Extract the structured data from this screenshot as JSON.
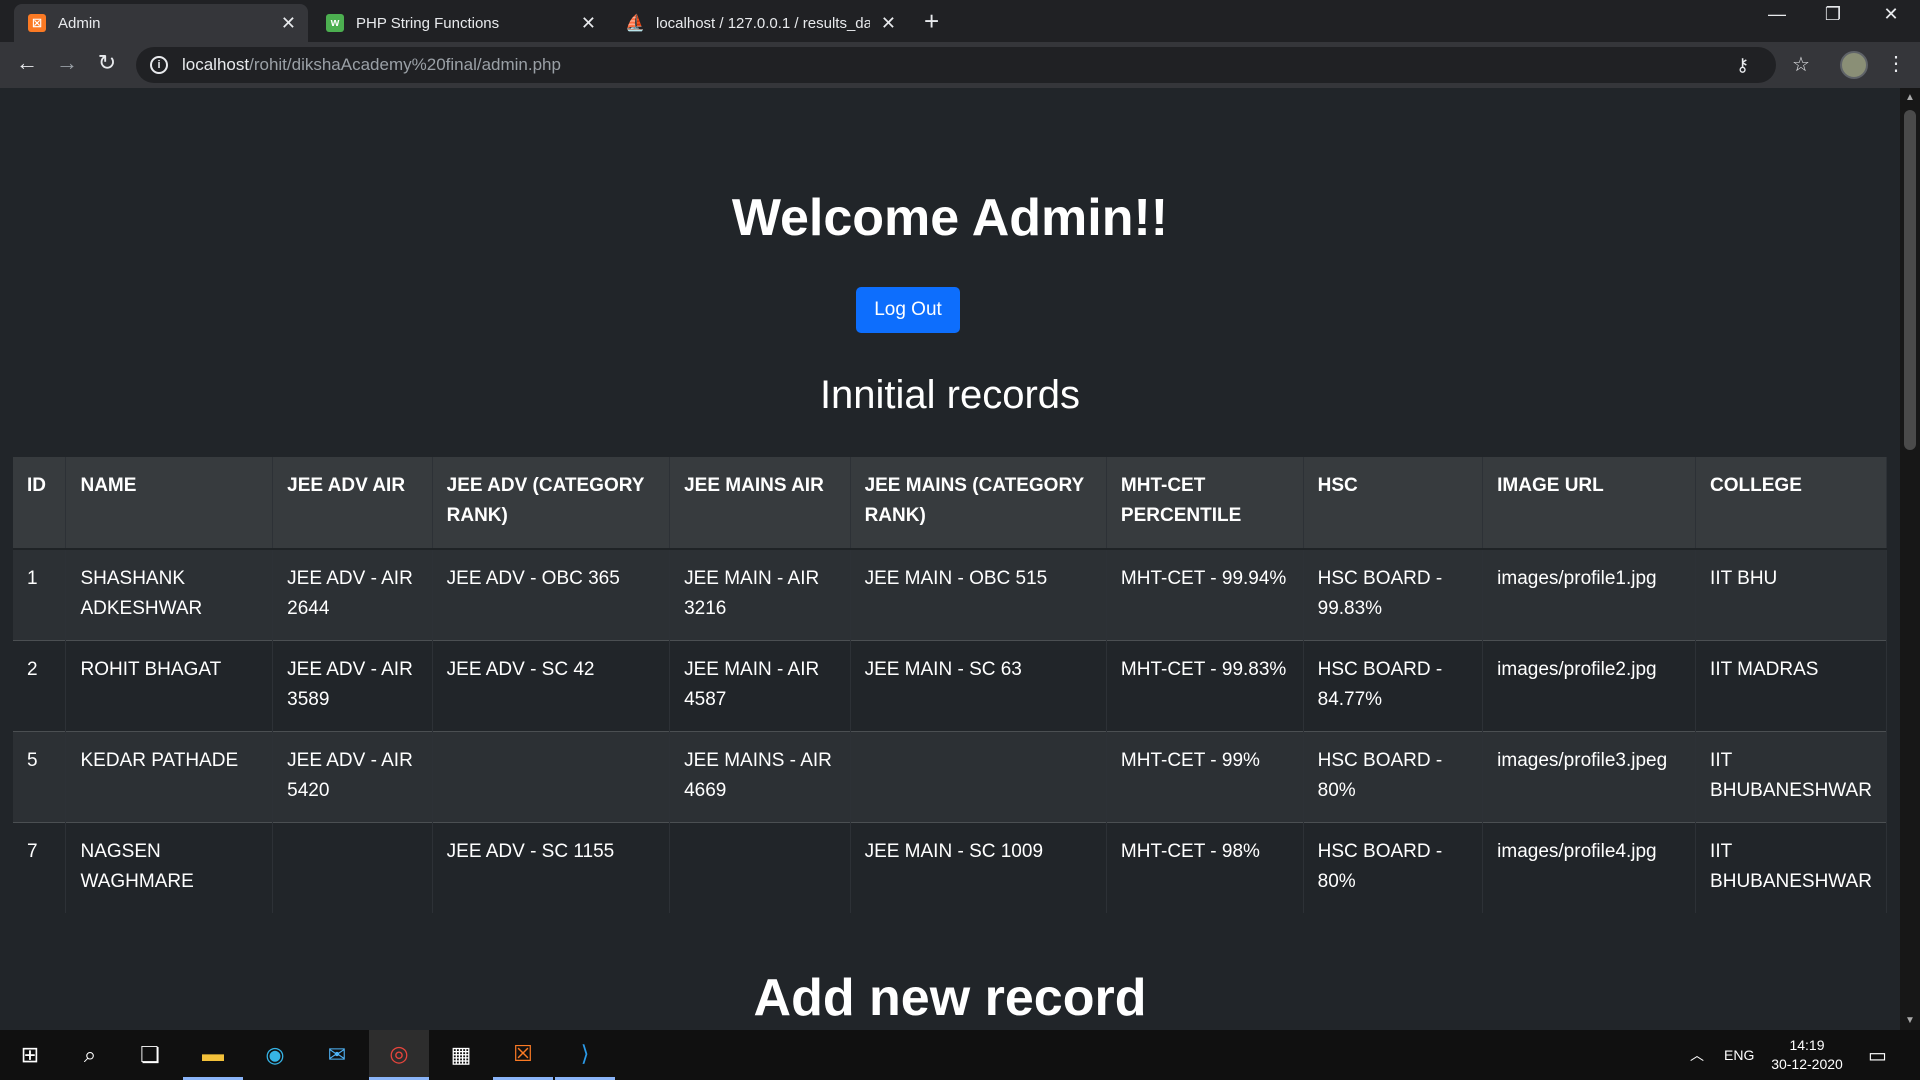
{
  "browser": {
    "tabs": [
      {
        "title": "Admin",
        "icon": "xampp-icon",
        "active": true
      },
      {
        "title": "PHP String Functions",
        "icon": "w3schools-icon",
        "active": false
      },
      {
        "title": "localhost / 127.0.0.1 / results_dat",
        "icon": "phpmyadmin-icon",
        "active": false
      }
    ],
    "url_host": "localhost",
    "url_path": "/rohit/dikshaAcademy%20final/admin.php"
  },
  "page": {
    "welcome": "Welcome Admin!!",
    "logout_label": "Log Out",
    "records_heading": "Innitial records",
    "add_heading": "Add new record",
    "table": {
      "headers": [
        "ID",
        "NAME",
        "JEE ADV AIR",
        "JEE ADV (CATEGORY RANK)",
        "JEE MAINS AIR",
        "JEE MAINS (CATEGORY RANK)",
        "MHT-CET PERCENTILE",
        "HSC",
        "IMAGE URL",
        "COLLEGE"
      ],
      "rows": [
        [
          "1",
          "SHASHANK ADKESHWAR",
          "JEE ADV - AIR 2644",
          "JEE ADV - OBC 365",
          "JEE MAIN - AIR 3216",
          "JEE MAIN - OBC 515",
          "MHT-CET - 99.94%",
          "HSC BOARD - 99.83%",
          "images/profile1.jpg",
          "IIT BHU"
        ],
        [
          "2",
          "ROHIT BHAGAT",
          "JEE ADV - AIR 3589",
          "JEE ADV - SC 42",
          "JEE MAIN - AIR 4587",
          "JEE MAIN - SC 63",
          "MHT-CET - 99.83%",
          "HSC BOARD - 84.77%",
          "images/profile2.jpg",
          "IIT MADRAS"
        ],
        [
          "5",
          "KEDAR PATHADE",
          "JEE ADV - AIR 5420",
          "",
          "JEE MAINS - AIR 4669",
          "",
          "MHT-CET - 99%",
          "HSC BOARD - 80%",
          "images/profile3.jpeg",
          "IIT BHUBANESHWAR"
        ],
        [
          "7",
          "NAGSEN WAGHMARE",
          "",
          "JEE ADV - SC 1155",
          "",
          "JEE MAIN - SC 1009",
          "MHT-CET - 98%",
          "HSC BOARD - 80%",
          "images/profile4.jpg",
          "IIT BHUBANESHWAR"
        ]
      ]
    }
  },
  "taskbar": {
    "lang": "ENG",
    "time": "14:19",
    "date": "30-12-2020"
  }
}
